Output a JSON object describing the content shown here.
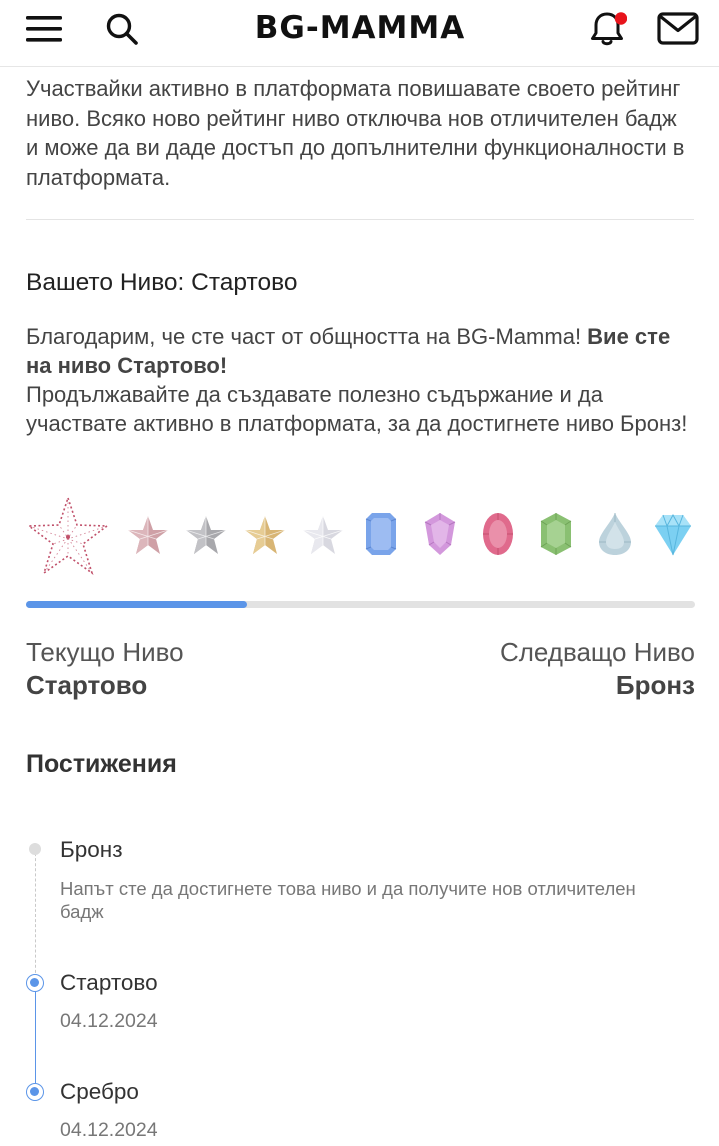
{
  "header": {
    "logo_text": "BG-MAMMA",
    "menu_icon": "hamburger-menu-icon",
    "search_icon": "search-icon",
    "notifications_icon": "bell-icon",
    "notification_dot_color": "#e8141c",
    "messages_icon": "envelope-icon"
  },
  "intro": {
    "text": "Участвайки активно в платформата повишавате своето рейтинг ниво. Всяко ново рейтинг ниво отключва нов отличителен бадж и може да ви даде достъп до допълнителни функционалности в платформата."
  },
  "level": {
    "title": "Вашето Ниво: Стартово",
    "thanks_prefix": "Благодарим, че сте част от общността на BG-Mamma! ",
    "thanks_bold": "Вие сте на ниво Стартово!",
    "thanks_suffix": "Продължавайте да създавате полезно съдържание и да участвате активно в платформата, за да достигнете ниво Бронз!",
    "progress_fraction": 0.33,
    "accent_color": "#5b95e8",
    "current_label": "Текущо Ниво",
    "current_value": "Стартово",
    "next_label": "Следващо Ниво",
    "next_value": "Бронз"
  },
  "badges": [
    {
      "icon": "star-outline-icon",
      "color": "#c0506a"
    },
    {
      "icon": "star-rose-icon",
      "color": "#cfa0a6"
    },
    {
      "icon": "star-silver-icon",
      "color": "#a8a8ac"
    },
    {
      "icon": "star-gold-icon",
      "color": "#d8b574"
    },
    {
      "icon": "star-platinum-icon",
      "color": "#d8d8e0"
    },
    {
      "icon": "sapphire-gem-icon",
      "color": "#7aa4ea"
    },
    {
      "icon": "amethyst-gem-icon",
      "color": "#d398dc"
    },
    {
      "icon": "ruby-gem-icon",
      "color": "#e06a8c"
    },
    {
      "icon": "emerald-gem-icon",
      "color": "#8ac072"
    },
    {
      "icon": "teardrop-gem-icon",
      "color": "#bcd2dc"
    },
    {
      "icon": "diamond-gem-icon",
      "color": "#7cd0f2"
    }
  ],
  "achievements": {
    "title": "Постижения",
    "items": [
      {
        "name": "Бронз",
        "description": "Напът сте да достигнете това ниво и да получите нов отличителен бадж"
      },
      {
        "name": "Стартово",
        "date": "04.12.2024"
      },
      {
        "name": "Сребро",
        "date": "04.12.2024"
      }
    ]
  }
}
